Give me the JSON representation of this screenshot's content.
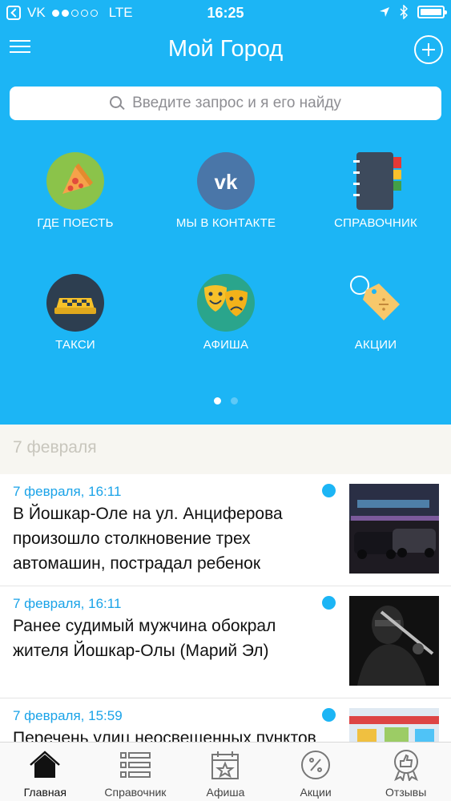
{
  "status_bar": {
    "carrier": "VK",
    "network": "LTE",
    "time": "16:25"
  },
  "header": {
    "title": "Мой Город"
  },
  "search": {
    "placeholder": "Введите запрос и я его найду"
  },
  "categories": [
    {
      "label": "ГДЕ ПОЕСТЬ",
      "icon": "pizza-icon"
    },
    {
      "label": "МЫ В КОНТАКТЕ",
      "icon": "vk-icon"
    },
    {
      "label": "СПРАВОЧНИК",
      "icon": "notebook-icon"
    },
    {
      "label": "ТАКСИ",
      "icon": "taxi-icon"
    },
    {
      "label": "АФИША",
      "icon": "theatre-masks-icon"
    },
    {
      "label": "АКЦИИ",
      "icon": "discount-tag-icon"
    }
  ],
  "pager": {
    "pages": 2,
    "current": 1
  },
  "section": {
    "date": "7 февраля"
  },
  "news": [
    {
      "time": "7 февраля, 16:11",
      "headline": "В Йошкар-Оле на ул. Анциферова произошло столкновение трех автомашин, пострадал ребенок",
      "unread": true,
      "thumb": "cars-night-photo"
    },
    {
      "time": "7 февраля, 16:11",
      "headline": "Ранее судимый мужчина обокрал жителя Йошкар-Олы (Марий Эл)",
      "unread": true,
      "thumb": "thief-photo"
    },
    {
      "time": "7 февраля, 15:59",
      "headline": "Перечень улиц неосвещенных пунктов",
      "unread": true,
      "thumb": "building-photo"
    }
  ],
  "tabbar": [
    {
      "label": "Главная",
      "icon": "home-icon",
      "active": true
    },
    {
      "label": "Справочник",
      "icon": "list-icon",
      "active": false
    },
    {
      "label": "Афиша",
      "icon": "calendar-star-icon",
      "active": false
    },
    {
      "label": "Акции",
      "icon": "percent-icon",
      "active": false
    },
    {
      "label": "Отзывы",
      "icon": "thumbs-up-badge-icon",
      "active": false
    }
  ],
  "colors": {
    "primary": "#1cb5f5",
    "time_text": "#1aa3e8",
    "section_bg": "#f7f6f1"
  }
}
